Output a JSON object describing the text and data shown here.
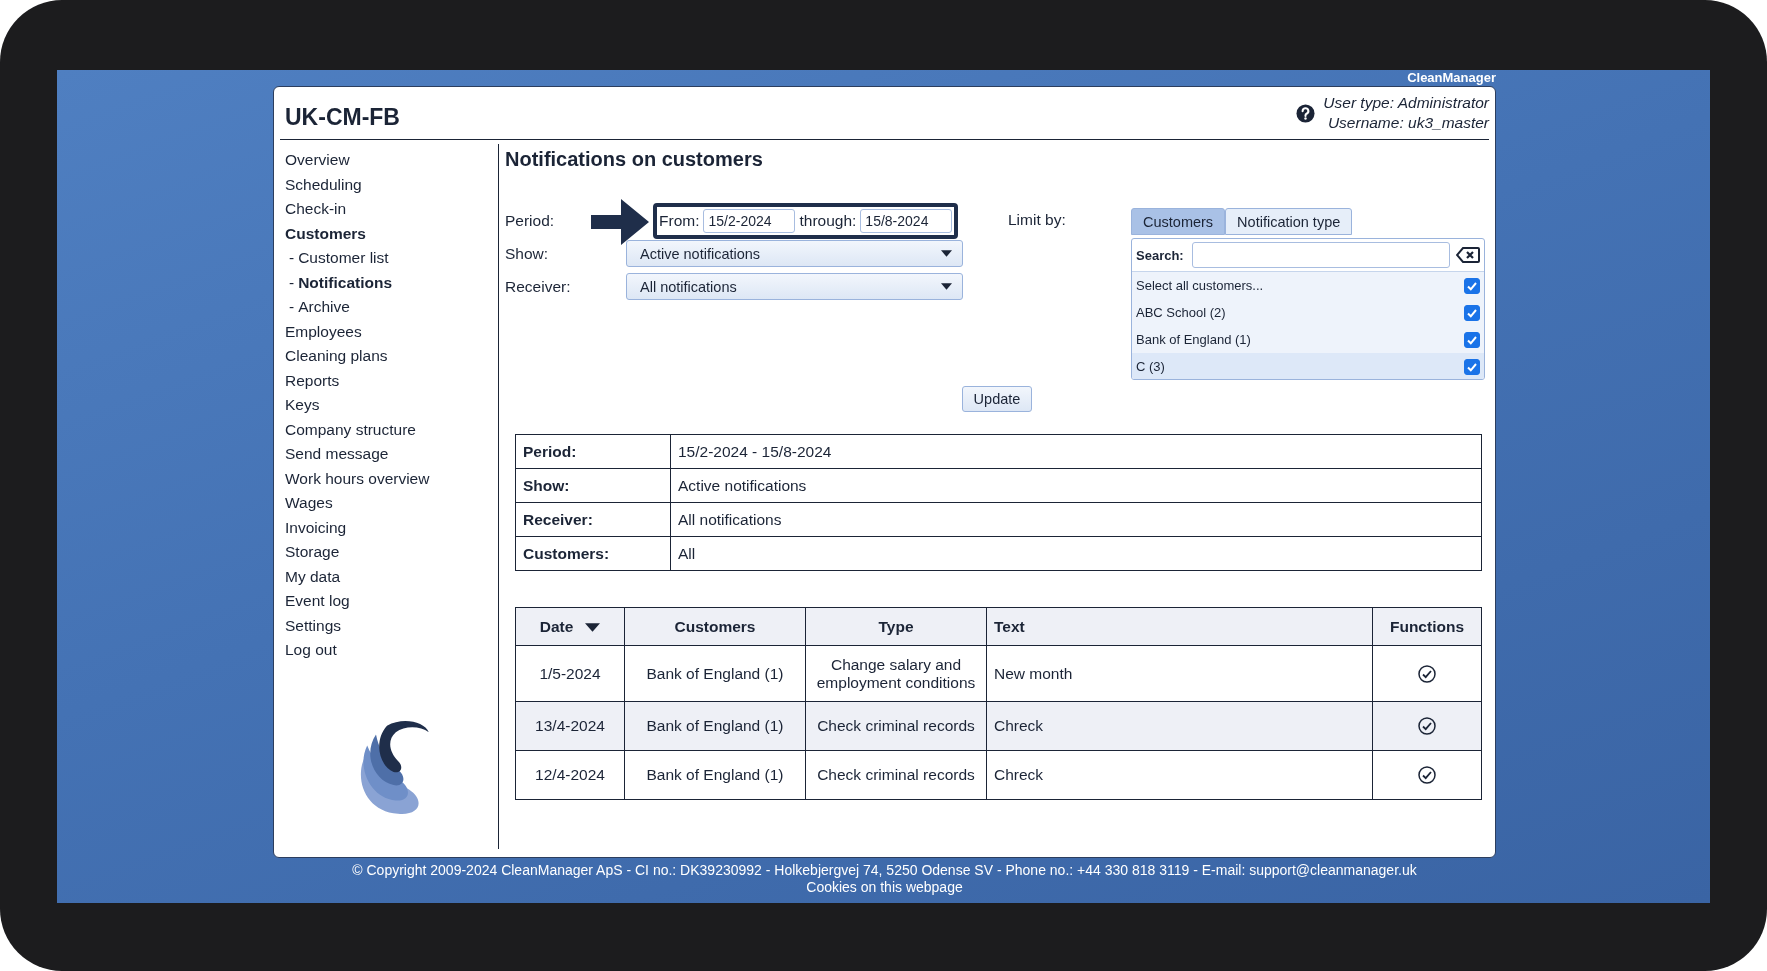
{
  "brand": "CleanManager",
  "header": {
    "title": "UK-CM-FB",
    "user_type": "User type: Administrator",
    "username": "Username: uk3_master"
  },
  "sidebar": {
    "items": [
      {
        "label": "Overview",
        "selected": false
      },
      {
        "label": "Scheduling",
        "selected": false
      },
      {
        "label": "Check-in",
        "selected": false
      },
      {
        "label": "Customers",
        "selected": true,
        "children": [
          {
            "prefix": "-",
            "label": "Customer list",
            "selected": false
          },
          {
            "prefix": "-",
            "label": "Notifications",
            "selected": true
          },
          {
            "prefix": "-",
            "label": "Archive",
            "selected": false
          }
        ]
      },
      {
        "label": "Employees",
        "selected": false
      },
      {
        "label": "Cleaning plans",
        "selected": false
      },
      {
        "label": "Reports",
        "selected": false
      },
      {
        "label": "Keys",
        "selected": false
      },
      {
        "label": "Company structure",
        "selected": false
      },
      {
        "label": "Send message",
        "selected": false
      },
      {
        "label": "Work hours overview",
        "selected": false
      },
      {
        "label": "Wages",
        "selected": false
      },
      {
        "label": "Invoicing",
        "selected": false
      },
      {
        "label": "Storage",
        "selected": false
      },
      {
        "label": "My data",
        "selected": false
      },
      {
        "label": "Event log",
        "selected": false
      },
      {
        "label": "Settings",
        "selected": false
      },
      {
        "label": "Log out",
        "selected": false
      }
    ]
  },
  "page": {
    "title": "Notifications on customers"
  },
  "form": {
    "period": {
      "label": "Period:",
      "from_label": "From:",
      "from": "15/2-2024",
      "through_label": "through:",
      "through": "15/8-2024",
      "highlighted": true
    },
    "show": {
      "label": "Show:",
      "value": "Active notifications"
    },
    "receiver": {
      "label": "Receiver:",
      "value": "All notifications"
    },
    "limit_by": {
      "label": "Limit by:",
      "tabs": [
        {
          "label": "Customers",
          "selected": true
        },
        {
          "label": "Notification type",
          "selected": false
        }
      ],
      "search_label": "Search:",
      "items": [
        {
          "label": "Select all customers...",
          "checked": true
        },
        {
          "label": "ABC School (2)",
          "checked": true
        },
        {
          "label": "Bank of England (1)",
          "checked": true
        },
        {
          "label": "C (3)",
          "checked": true
        }
      ]
    },
    "update_button": "Update"
  },
  "summary": [
    {
      "label": "Period:",
      "value": "15/2-2024 - 15/8-2024"
    },
    {
      "label": "Show:",
      "value": "Active notifications"
    },
    {
      "label": "Receiver:",
      "value": "All notifications"
    },
    {
      "label": "Customers:",
      "value": "All"
    }
  ],
  "table": {
    "columns": [
      {
        "label": "Date",
        "sorted": true
      },
      {
        "label": "Customers",
        "sorted": false
      },
      {
        "label": "Type",
        "sorted": false
      },
      {
        "label": "Text",
        "sorted": false
      },
      {
        "label": "Functions",
        "sorted": false
      }
    ],
    "rows": [
      {
        "date": "1/5-2024",
        "customers": "Bank of England (1)",
        "type": "Change salary and employment conditions",
        "text": "New month"
      },
      {
        "date": "13/4-2024",
        "customers": "Bank of England (1)",
        "type": "Check criminal records",
        "text": "Chreck"
      },
      {
        "date": "12/4-2024",
        "customers": "Bank of England (1)",
        "type": "Check criminal records",
        "text": "Chreck"
      }
    ]
  },
  "footer": {
    "copyright": "© Copyright 2009-2024 CleanManager ApS - CI no.: DK39230992 - Holkebjergvej 74, 5250 Odense SV - Phone no.: +44 330 818 3119 - E-mail: support@cleanmanager.uk",
    "cookies": "Cookies on this webpage"
  }
}
